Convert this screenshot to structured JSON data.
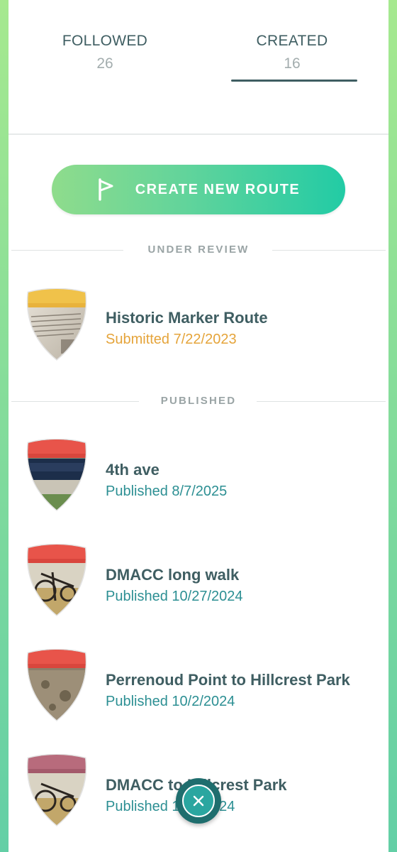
{
  "tabs": {
    "followed": {
      "label": "FOLLOWED",
      "count": "26"
    },
    "created": {
      "label": "CREATED",
      "count": "16"
    }
  },
  "create_button": {
    "label": "CREATE NEW ROUTE",
    "icon": "flag-icon"
  },
  "sections": {
    "under_review": "UNDER REVIEW",
    "published": "PUBLISHED"
  },
  "under_review_routes": [
    {
      "name": "Historic Marker Route",
      "status": "Submitted 7/22/2023"
    }
  ],
  "published_routes": [
    {
      "name": "4th ave",
      "status": "Published 8/7/2025"
    },
    {
      "name": "DMACC long walk",
      "status": "Published 10/27/2024"
    },
    {
      "name": "Perrenoud Point to Hillcrest Park",
      "status": "Published 10/2/2024"
    },
    {
      "name": "DMACC to Hillcrest Park",
      "status": "Published 10/2/2024"
    }
  ],
  "colors": {
    "text_primary": "#3f5e62",
    "submitted_status": "#e5a43a",
    "published_status": "#2c8f93",
    "review_shield_band": "#f0c24a",
    "published_shield_band": "#e8544a"
  },
  "close_button": {
    "icon": "close-icon"
  }
}
